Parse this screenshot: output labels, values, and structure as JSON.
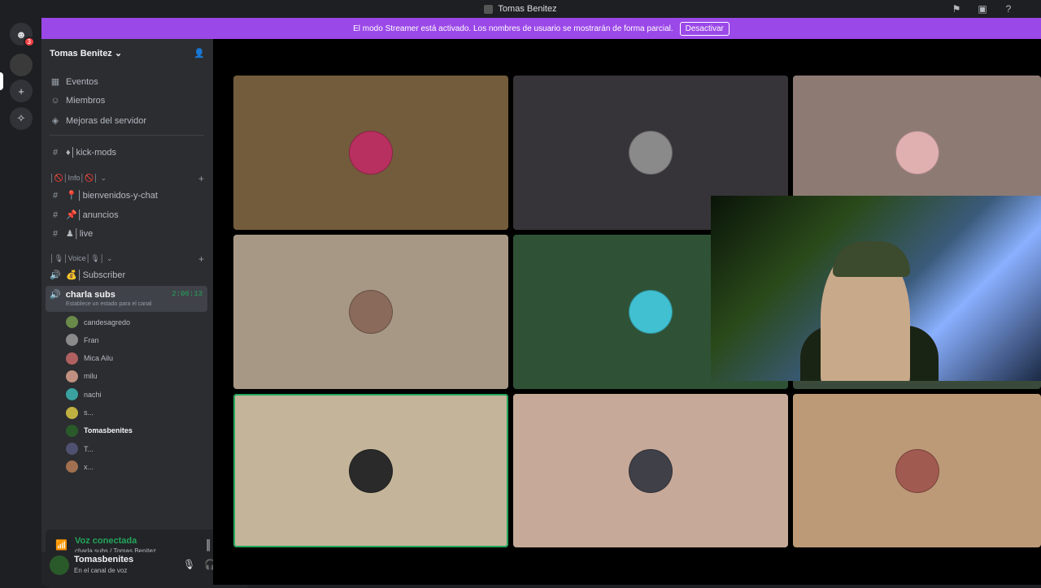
{
  "window": {
    "title": "Tomas Benitez"
  },
  "banner": {
    "text": "El modo Streamer está activado. Los nombres de usuario se mostrarán de forma parcial.",
    "button": "Desactivar"
  },
  "rail": {
    "badge": "3"
  },
  "server": {
    "name": "Tomas Benitez"
  },
  "nav": {
    "events": "Eventos",
    "members": "Miembros",
    "boosts": "Mejoras del servidor"
  },
  "channels": {
    "kick_mods": "♦│kick-mods",
    "cat_info": "│🚫│Info│🚫│",
    "welcome": "📍│bienvenidos-y-chat",
    "announcements": "📌│anuncios",
    "live": "♟│live",
    "cat_voice": "│🎙│Voice│🎙│",
    "subscriber": "💰│Subscriber",
    "voice_active": "charla subs",
    "voice_timer": "2:06:13",
    "voice_status": "Establece un estado para el canal"
  },
  "members": [
    {
      "name": "candesagredo",
      "color": "#6a8a4a"
    },
    {
      "name": "Fran",
      "color": "#8a8a8a"
    },
    {
      "name": "Mica Ailu",
      "color": "#b06060"
    },
    {
      "name": "milu",
      "color": "#c09080"
    },
    {
      "name": "nachi",
      "color": "#3aa0a0"
    },
    {
      "name": "s...",
      "color": "#c0b040"
    },
    {
      "name": "Tomasbenites",
      "color": "#2a5a2a"
    },
    {
      "name": "T...",
      "color": "#505070"
    },
    {
      "name": "x...",
      "color": "#a07050"
    }
  ],
  "voice": {
    "status": "Voz conectada",
    "location": "charla subs / Tomas Benitez"
  },
  "user": {
    "name": "Tomasbenites",
    "status": "En el canal de voz"
  },
  "tiles": [
    {
      "bg": "#725c3b",
      "avatar": "#b83060"
    },
    {
      "bg": "#363438",
      "avatar": "#8a8a8a"
    },
    {
      "bg": "#8d7b73",
      "avatar": "#e0b0b0"
    },
    {
      "bg": "#a79886",
      "avatar": "#8a6a5a"
    },
    {
      "bg": "#2f5236",
      "avatar": "#40c0d0"
    },
    {
      "bg": "#3a4a3a",
      "avatar": "#556655"
    },
    {
      "bg": "#c4b59a",
      "avatar": "#2a2a2a",
      "speaking": true
    },
    {
      "bg": "#c7a999",
      "avatar": "#404048"
    },
    {
      "bg": "#bd9a77",
      "avatar": "#a05a50"
    }
  ]
}
